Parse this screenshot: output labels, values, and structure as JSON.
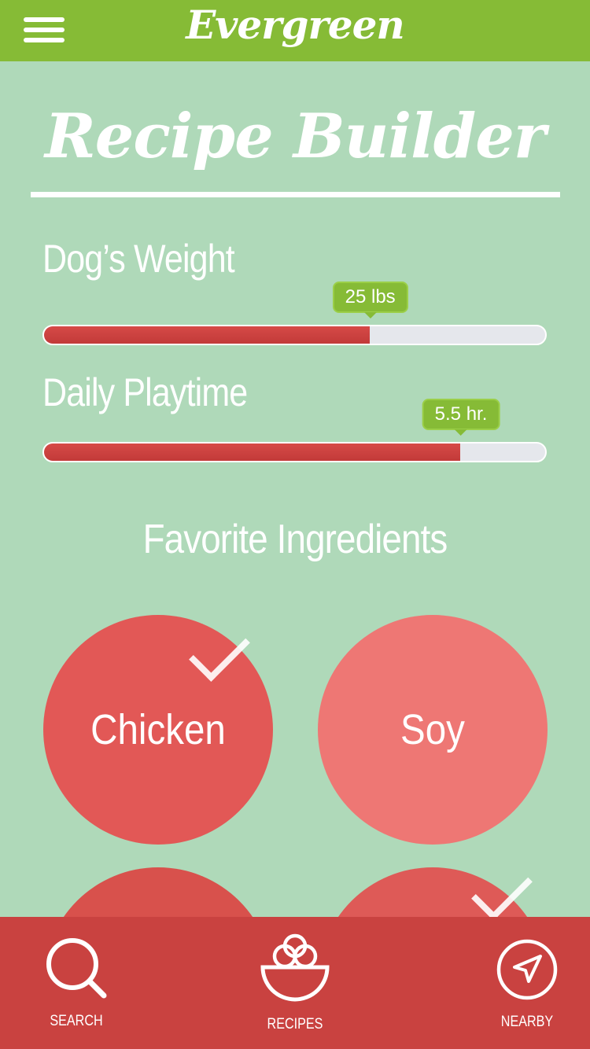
{
  "header": {
    "brand": "Evergreen",
    "menu_icon": "hamburger-menu-icon"
  },
  "title": "Recipe Builder",
  "sliders": [
    {
      "label": "Dog’s Weight",
      "value_text": "25 lbs",
      "fill_fraction": 0.65
    },
    {
      "label": "Daily Playtime",
      "value_text": "5.5 hr.",
      "fill_fraction": 0.83
    }
  ],
  "favorites": {
    "title": "Favorite Ingredients",
    "items": [
      {
        "label": "Chicken",
        "selected": true
      },
      {
        "label": "Soy",
        "selected": false
      },
      {
        "label": "",
        "selected": false
      },
      {
        "label": "",
        "selected": true
      }
    ]
  },
  "nav": {
    "items": [
      {
        "label": "SEARCH",
        "icon": "search-icon"
      },
      {
        "label": "RECIPES",
        "icon": "bowl-icon"
      },
      {
        "label": "NEARBY",
        "icon": "navigation-arrow-icon"
      }
    ]
  },
  "colors": {
    "background": "#afd9b9",
    "header": "#86bb36",
    "accent_red": "#c94240",
    "slider_fill": "#c23a39"
  }
}
